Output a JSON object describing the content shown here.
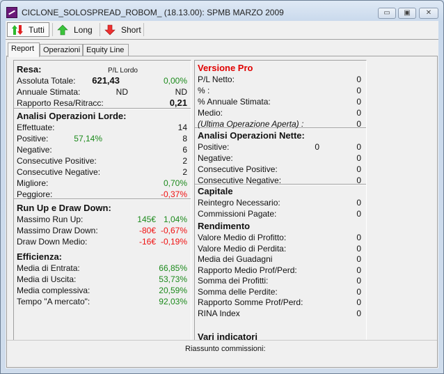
{
  "window": {
    "title": "CICLONE_SOLOSPREAD_ROBOM_ (18.13.00): SPMB MARZO 2009",
    "minimize": "▭",
    "maximize": "▣",
    "close": "✕"
  },
  "toolbar": {
    "buttons": [
      {
        "label": "Tutti",
        "icon": "up-down-arrows-icon",
        "active": true
      },
      {
        "label": "Long",
        "icon": "green-up-arrow-icon"
      },
      {
        "label": "Short",
        "icon": "red-down-arrow-icon"
      }
    ]
  },
  "tabs": [
    {
      "label": "Report",
      "active": true
    },
    {
      "label": "Operazioni"
    },
    {
      "label": "Equity Line"
    }
  ],
  "colors": {
    "green": "#1c8a1c",
    "red": "#f01010",
    "pro": "#e00000"
  },
  "left": {
    "pl_lordo_label": "P/L Lordo",
    "sections": [
      {
        "title": "Resa:",
        "rows": [
          {
            "label": "Assoluta Totale:",
            "mid": "621,43",
            "value": "0,00%",
            "value_color": "green",
            "mid_bold": true
          },
          {
            "label": "Annuale Stimata:",
            "mid": "ND",
            "value": "ND"
          },
          {
            "label": "Rapporto Resa/Ritracc:",
            "value": "0,21",
            "value_bold": true
          }
        ]
      },
      {
        "title": "Analisi Operazioni Lorde:",
        "rows": [
          {
            "label": "Effettuate:",
            "value": "14"
          },
          {
            "label": "Positive:",
            "mid": "57,14%",
            "mid_color": "green",
            "value": "8"
          },
          {
            "label": "Negative:",
            "value": "6"
          },
          {
            "label": "Consecutive Positive:",
            "value": "2"
          },
          {
            "label": "Consecutive Negative:",
            "value": "2"
          },
          {
            "label": "Migliore:",
            "value": "0,70%",
            "value_color": "green"
          },
          {
            "label": "Peggiore:",
            "value": "-0,37%",
            "value_color": "red"
          }
        ]
      },
      {
        "title": "Run Up e Draw Down:",
        "rows": [
          {
            "label": "Massimo Run Up:",
            "mid": "145€",
            "mid_color": "green",
            "value": "1,04%",
            "value_color": "green"
          },
          {
            "label": "Massimo Draw Down:",
            "mid": "-80€",
            "mid_color": "red",
            "value": "-0,67%",
            "value_color": "red"
          },
          {
            "label": "Draw Down Medio:",
            "mid": "-16€",
            "mid_color": "red",
            "value": "-0,19%",
            "value_color": "red"
          }
        ]
      },
      {
        "title": "Efficienza:",
        "rows": [
          {
            "label": "Media di Entrata:",
            "value": "66,85%",
            "value_color": "green"
          },
          {
            "label": "Media di Uscita:",
            "value": "53,73%",
            "value_color": "green"
          },
          {
            "label": "Media complessiva:",
            "value": "20,59%",
            "value_color": "green"
          },
          {
            "label": "Tempo \"A mercato\":",
            "value": "92,03%",
            "value_color": "green"
          }
        ]
      }
    ]
  },
  "right": {
    "sections": [
      {
        "title": "Versione Pro",
        "title_color": "pro",
        "rows": [
          {
            "label": "P/L Netto:",
            "value": "0"
          },
          {
            "label": "% :",
            "value": "0"
          },
          {
            "label": "% Annuale Stimata:",
            "value": "0"
          },
          {
            "label": "Medio:",
            "value": "0"
          },
          {
            "label": "(Ultima Operazione Aperta) :",
            "value": "0",
            "italic": true
          }
        ]
      },
      {
        "title": "Analisi Operazioni Nette:",
        "rows": [
          {
            "label": "Positive:",
            "mid": "0",
            "value": "0"
          },
          {
            "label": "Negative:",
            "value": "0"
          },
          {
            "label": "Consecutive Positive:",
            "value": "0"
          },
          {
            "label": "Consecutive Negative:",
            "value": "0"
          }
        ]
      },
      {
        "title": "Capitale",
        "rows": [
          {
            "label": "Reintegro Necessario:",
            "value": "0"
          },
          {
            "label": "Commissioni Pagate:",
            "value": "0"
          }
        ]
      },
      {
        "title": "Rendimento",
        "rows": [
          {
            "label": "Valore Medio di Profitto:",
            "value": "0"
          },
          {
            "label": "Valore Medio di Perdita:",
            "value": "0"
          },
          {
            "label": "Media dei Guadagni",
            "value": "0"
          },
          {
            "label": "Rapporto Medio Prof/Perd:",
            "value": "0"
          },
          {
            "label": "Somma dei Profitti:",
            "value": "0"
          },
          {
            "label": "Somma delle Perdite:",
            "value": "0"
          },
          {
            "label": "Rapporto Somme Prof/Perd:",
            "value": "0"
          },
          {
            "label": "RINA Index",
            "value": "0"
          }
        ]
      },
      {
        "title": "Vari indicatori",
        "rows": []
      }
    ]
  },
  "bottom": {
    "label": "Riassunto commissioni:"
  }
}
